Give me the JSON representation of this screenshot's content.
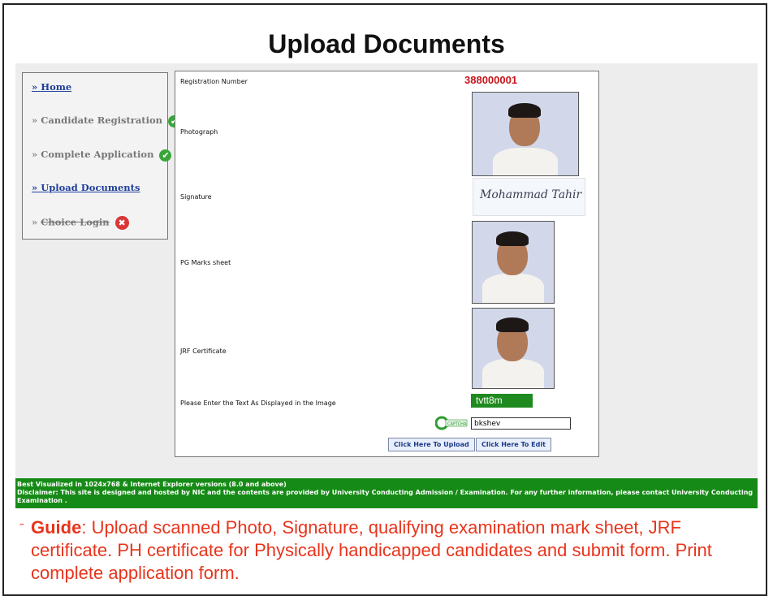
{
  "slide": {
    "title": "Upload Documents",
    "guide": {
      "bullet": "˝",
      "keyword": "Guide",
      "text": ": Upload scanned Photo, Signature, qualifying examination mark sheet, JRF certificate. PH certificate for Physically handicapped candidates and submit form. Print complete application form."
    }
  },
  "sidebar": {
    "items": [
      {
        "arrow": "»",
        "label": "Home",
        "status": "",
        "state": "link"
      },
      {
        "arrow": "»",
        "label": "Candidate Registration",
        "status": "done",
        "state": "normal"
      },
      {
        "arrow": "»",
        "label": "Complete Application",
        "status": "done",
        "state": "normal"
      },
      {
        "arrow": "»",
        "label": "Upload Documents",
        "status": "",
        "state": "link"
      },
      {
        "arrow": "»",
        "label": "Choice Login",
        "status": "blocked",
        "state": "disabled"
      }
    ],
    "icons": {
      "done": "check-circle-icon",
      "blocked": "x-circle-icon"
    },
    "glyphs": {
      "done": "✔",
      "blocked": "✖"
    }
  },
  "form": {
    "registration_label": "Registration Number",
    "registration_value": "388000001",
    "photograph_label": "Photograph",
    "signature_label": "Signature",
    "signature_value": "Mohammad Tahir",
    "pg_marks_label": "PG Marks sheet",
    "jrf_label": "JRF Certificate",
    "captcha_prompt": "Please Enter the Text As Displayed in the Image",
    "captcha_text": "tvtt8m",
    "captcha_logo": "CAPTCHA",
    "captcha_input_value": "bkshev",
    "upload_button": "Click Here To Upload",
    "edit_button": "Click Here To Edit"
  },
  "footer": {
    "line1": "Best Visualized in 1024x768 & Internet Explorer versions (8.0 and above)",
    "line2": "Disclaimer: This site is designed and hosted by NIC and the contents are provided by University Conducting Admission / Examination. For any further information, please contact University Conducting Examination ."
  },
  "colors": {
    "accent_red": "#c8151b",
    "footer_green": "#168a16",
    "guide_red": "#e8341c",
    "link_blue": "#1f3f9c"
  }
}
